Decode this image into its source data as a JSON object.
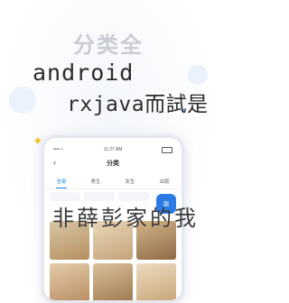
{
  "banner": {
    "title": "分类全"
  },
  "overlay": {
    "line1": "android",
    "line2": "rxjava而試是",
    "line3": "非薛彭家的我"
  },
  "phone": {
    "statusbar": {
      "carrier": "•••• ≈",
      "time": "11:27 AM"
    },
    "navbar": {
      "back_icon": "‹",
      "title": "分类"
    },
    "tabs": [
      {
        "label": "全部"
      },
      {
        "label": "男生"
      },
      {
        "label": "女生"
      },
      {
        "label": "出版"
      }
    ],
    "side_icon": "≡"
  },
  "colors": {
    "accent": "#1e88e5",
    "banner_text": "#c9ccd3",
    "overlay_text": "#2b2b2b",
    "sparkle": "#f2c21b"
  }
}
